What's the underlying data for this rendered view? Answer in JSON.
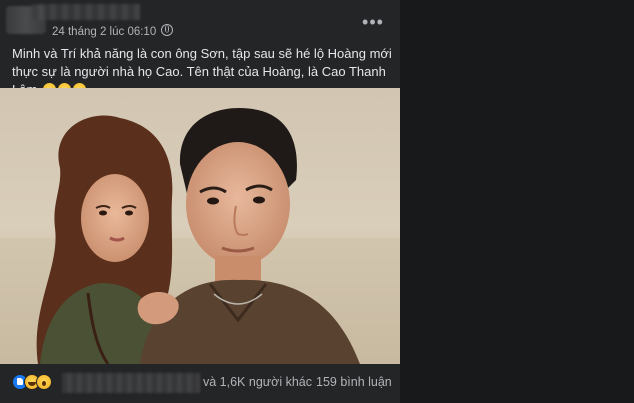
{
  "post": {
    "timestamp": "24 tháng 2 lúc 06:10",
    "more_label": "•••",
    "caption": "Minh và Trí khả năng là con ông Sơn, tập sau sẽ hé lộ Hoàng mới thực sự là người nhà họ Cao. Tên thật của Hoàng, là Cao Thanh Lâm",
    "caption_emojis": [
      "dizzy-face-emoji",
      "dizzy-face-emoji",
      "dizzy-face-emoji"
    ]
  },
  "reactions": {
    "icons": [
      "like-icon",
      "haha-icon",
      "wow-icon"
    ],
    "others_text": "và 1,6K người khác",
    "comments_text": "159 bình luận"
  }
}
